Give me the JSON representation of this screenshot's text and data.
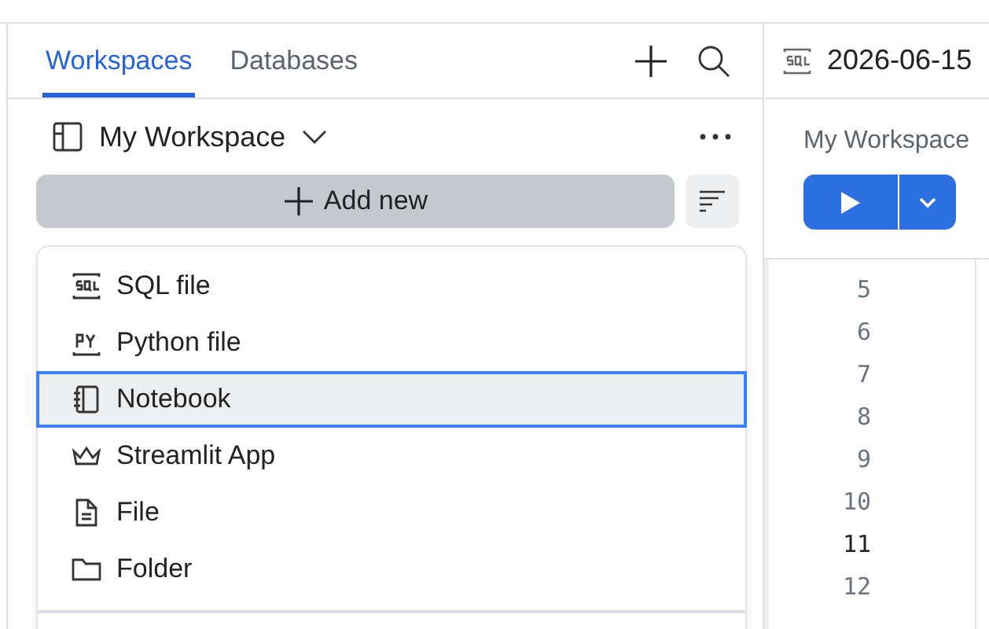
{
  "sidebar": {
    "tabs": [
      {
        "label": "Workspaces",
        "selected": true
      },
      {
        "label": "Databases",
        "selected": false
      }
    ],
    "workspace": "My Workspace",
    "add_button": "Add new"
  },
  "add_menu": {
    "items": [
      {
        "kind": "sql",
        "label": "SQL file",
        "selected": false
      },
      {
        "kind": "python",
        "label": "Python file",
        "selected": false
      },
      {
        "kind": "notebook",
        "label": "Notebook",
        "selected": true
      },
      {
        "kind": "app",
        "label": "Streamlit App",
        "selected": false
      },
      {
        "kind": "file",
        "label": "File",
        "selected": false
      },
      {
        "kind": "folder",
        "label": "Folder",
        "selected": false
      }
    ]
  },
  "editor": {
    "tab_title": "2026-06-15",
    "workspace": "My Workspace",
    "line_numbers": [
      {
        "text": "5",
        "current": false
      },
      {
        "text": "6",
        "current": false
      },
      {
        "text": "7",
        "current": false
      },
      {
        "text": "8",
        "current": false
      },
      {
        "text": "9",
        "current": false
      },
      {
        "text": "10",
        "current": false
      },
      {
        "text": "11",
        "current": true
      },
      {
        "text": "12",
        "current": false
      }
    ]
  }
}
